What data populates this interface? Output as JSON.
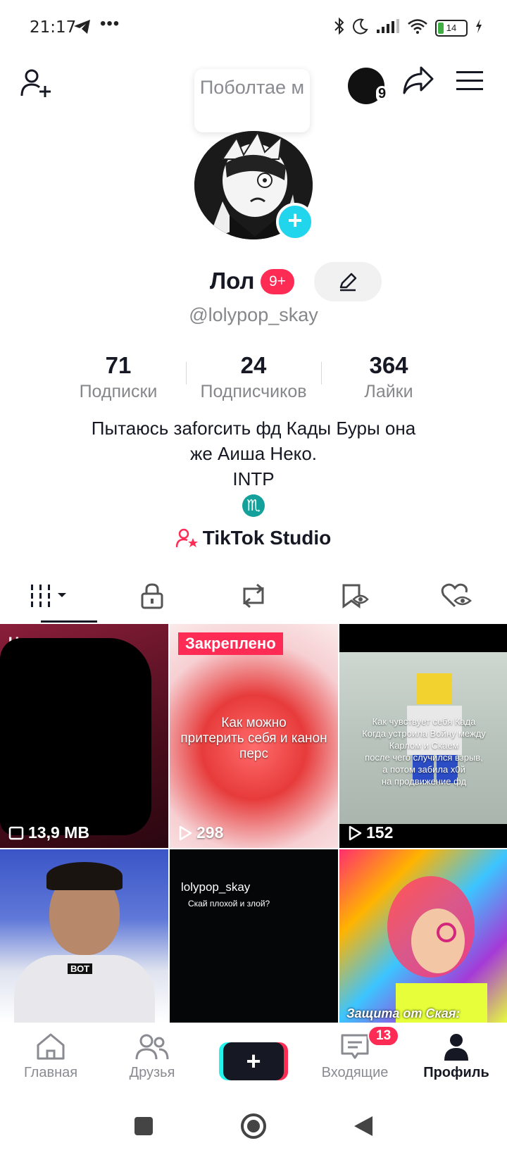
{
  "status_bar": {
    "time": "21:17",
    "dots": "•••",
    "battery": "14"
  },
  "header": {
    "tooltip": "Поболтае м",
    "story_count": "9"
  },
  "profile": {
    "name": "Лол",
    "notif_badge": "9+",
    "handle": "@lolypop_skay",
    "stats": [
      {
        "value": "71",
        "label": "Подписки"
      },
      {
        "value": "24",
        "label": "Подписчиков"
      },
      {
        "value": "364",
        "label": "Лайки"
      }
    ],
    "bio_line1": "Пытаюсь заforсить фд Кады Буры она",
    "bio_line2": "же Аиша Неко.",
    "bio_line3": "INTP",
    "zodiac": "♏",
    "studio": "TikTok Studio"
  },
  "grid": [
    {
      "top": "Че",
      "views": "13,9 MB"
    },
    {
      "pin": "Закреплено",
      "overlay": "Как можно\nпритерить себя и канон перс",
      "views": "298"
    },
    {
      "overlay": "Как чувствует себя Када\nКогда устроила Войну между\nКарлом и Скаем\nпосле чего случился взрыв,\nа потом забила х0й\nна продвижение фд",
      "views": "152"
    },
    {
      "overlay": "ВОТ"
    },
    {
      "user": "lolypop_skay",
      "overlay": "Скай плохой и злой?"
    },
    {
      "caption": "Защита от Ская:"
    }
  ],
  "bottom_nav": {
    "home": "Главная",
    "friends": "Друзья",
    "inbox": "Входящие",
    "inbox_badge": "13",
    "profile": "Профиль"
  },
  "colors": {
    "accent": "#fe2c55",
    "cyan": "#25f4ee",
    "text": "#161823",
    "muted": "#86878b"
  }
}
